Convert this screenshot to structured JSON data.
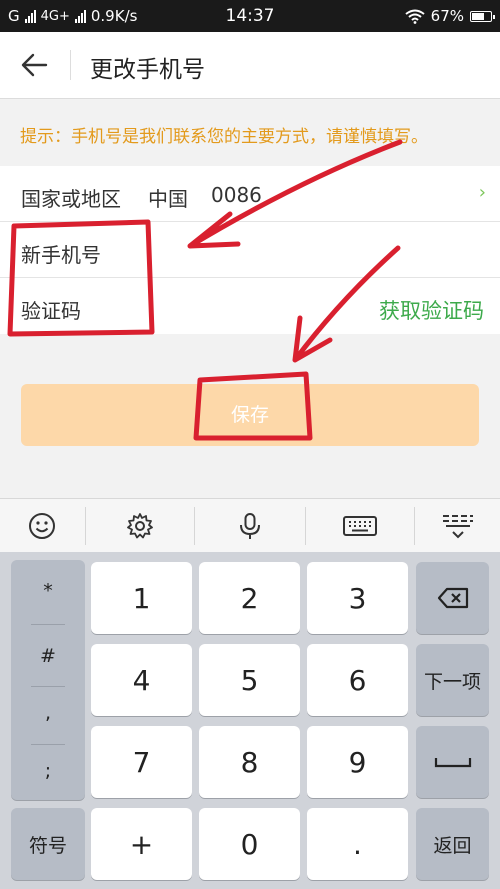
{
  "status_bar": {
    "carrier_1": "G",
    "network": "4G+",
    "speed": "0.9K/s",
    "time": "14:37",
    "battery": "67%"
  },
  "header": {
    "back_icon": "arrow-left-icon",
    "title": "更改手机号"
  },
  "tip": "提示：手机号是我们联系您的主要方式，请谨慎填写。",
  "form": {
    "region_label": "国家或地区",
    "region_value": "中国",
    "region_code": "0086",
    "region_chevron": "›",
    "phone_placeholder": "新手机号",
    "code_placeholder": "验证码",
    "get_code_label": "获取验证码"
  },
  "save_label": "保存",
  "keyboard": {
    "toolbar_icons": [
      "smiley-icon",
      "gear-icon",
      "microphone-icon",
      "keyboard-icon",
      "collapse-keyboard-icon"
    ],
    "symbols": [
      "*",
      "#",
      ",",
      ";"
    ],
    "digits": [
      "1",
      "2",
      "3",
      "4",
      "5",
      "6",
      "7",
      "8",
      "9"
    ],
    "plus": "+",
    "zero": "0",
    "dot": ".",
    "symbol_key": "符号",
    "next_key": "下一项",
    "return_key": "返回",
    "backspace_icon": "backspace-icon",
    "space_icon": "space-icon"
  },
  "colors": {
    "accent_green": "#3daa4b",
    "tip_orange": "#e39a1c",
    "save_bg": "#fdd8a9",
    "annotation_red": "#d9202f"
  }
}
